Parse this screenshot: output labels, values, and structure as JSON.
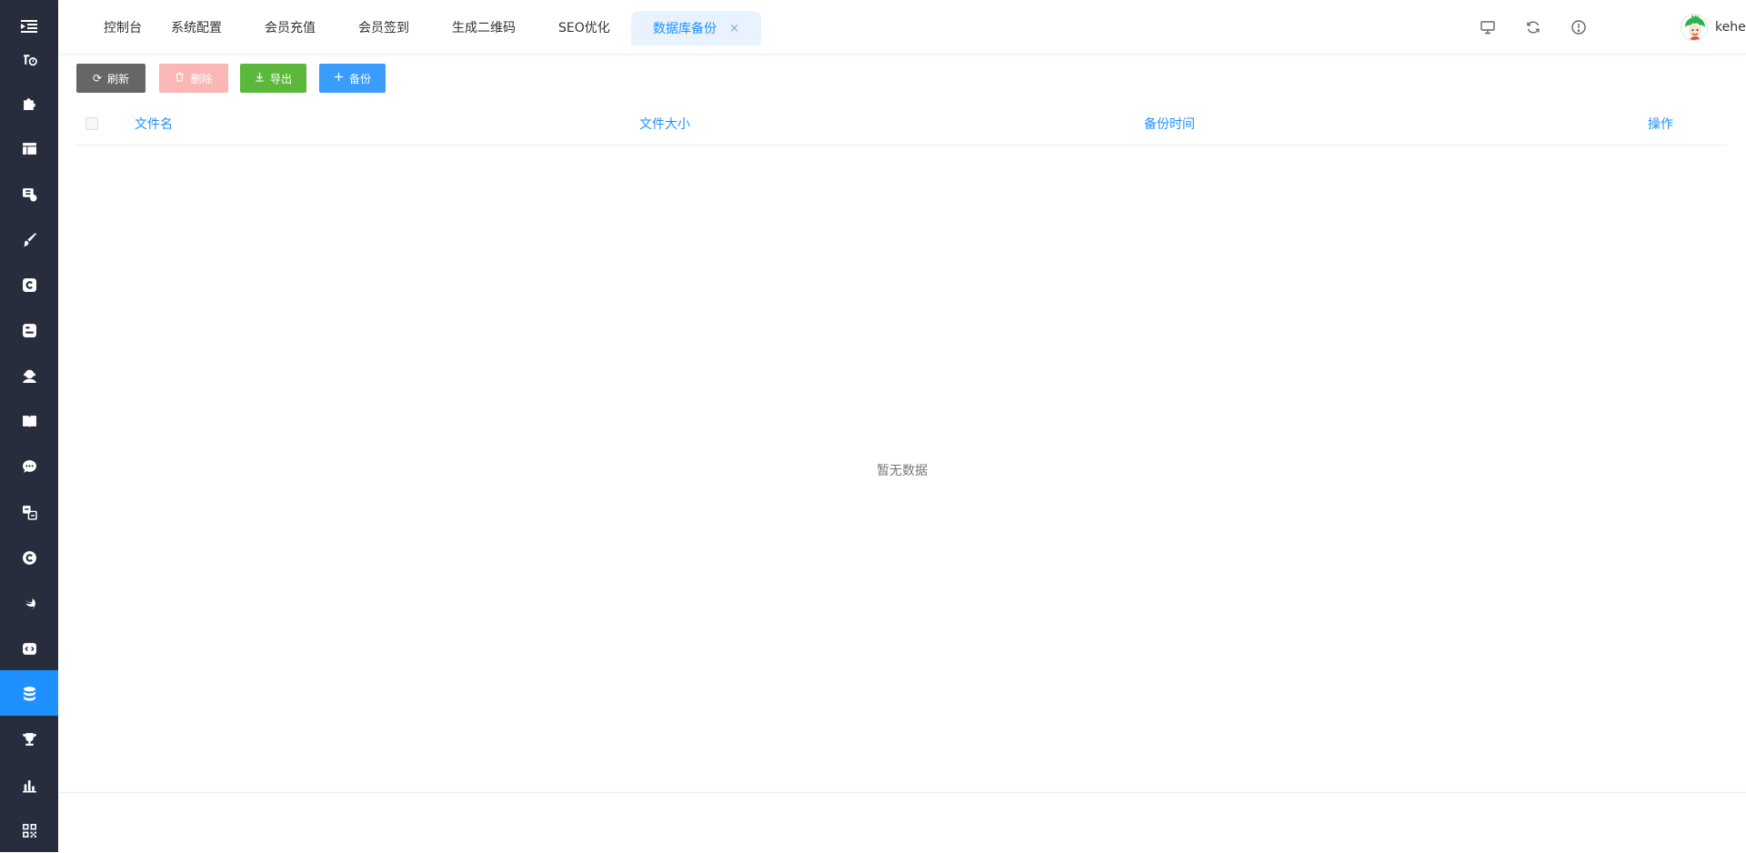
{
  "tabs": [
    {
      "label": "控制台"
    },
    {
      "label": "系统配置"
    },
    {
      "label": "会员充值"
    },
    {
      "label": "会员签到"
    },
    {
      "label": "生成二维码"
    },
    {
      "label": "SEO优化"
    },
    {
      "label": "数据库备份",
      "close": "×"
    }
  ],
  "header": {
    "username": "keheying",
    "icons": [
      "monitor-icon",
      "refresh-icon",
      "info-icon"
    ]
  },
  "sidebar": {
    "icons": [
      "indent-icon",
      "settings-icon",
      "puzzle-icon",
      "layout-icon",
      "image-icon",
      "brush-icon",
      "c-icon",
      "blog-icon",
      "support-icon",
      "book-icon",
      "chat-icon",
      "translate-icon",
      "c-circle-icon",
      "bird-icon",
      "code-icon",
      "database-icon",
      "trophy-icon",
      "chart-icon",
      "qrcode-icon"
    ],
    "active": "database-icon"
  },
  "toolbar": {
    "refresh": "刷新",
    "delete": "删除",
    "export": "导出",
    "backup": "备份"
  },
  "table": {
    "columns": [
      "文件名",
      "文件大小",
      "备份时间",
      "操作"
    ],
    "rows": [],
    "empty_text": "暂无数据"
  },
  "colors": {
    "sidebar_bg": "#272d3c",
    "accent": "#1e90ff",
    "refresh_btn": "#666666",
    "delete_btn": "#fbb6b6",
    "export_btn": "#5cb83c",
    "backup_btn": "#3a9cfc"
  }
}
